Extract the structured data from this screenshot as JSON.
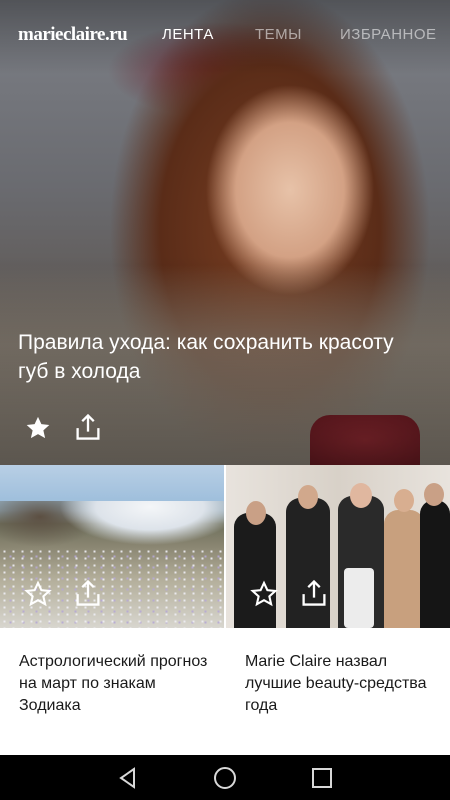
{
  "header": {
    "logo": "marieclaire.ru",
    "tabs": [
      {
        "label": "ЛЕНТА",
        "active": true
      },
      {
        "label": "ТЕМЫ",
        "active": false
      },
      {
        "label": "ИЗБРАННОЕ",
        "active": false
      }
    ]
  },
  "hero": {
    "title": "Правила ухода: как сохранить красоту губ в холода",
    "favorite_icon": "star-filled-icon",
    "share_icon": "share-icon"
  },
  "cards": [
    {
      "title": "Астрологический прогноз на март по знакам Зодиака",
      "favorite_icon": "star-outline-icon",
      "share_icon": "share-icon"
    },
    {
      "title": "Marie Claire назвал лучшие beauty-средства года",
      "favorite_icon": "star-outline-icon",
      "share_icon": "share-icon"
    }
  ],
  "navbar": {
    "back_icon": "back-triangle-icon",
    "home_icon": "home-circle-icon",
    "recents_icon": "recents-square-icon"
  },
  "colors": {
    "text_dark": "#1a1a1a",
    "nav_background": "#000000",
    "overlay_text": "#ffffff"
  }
}
